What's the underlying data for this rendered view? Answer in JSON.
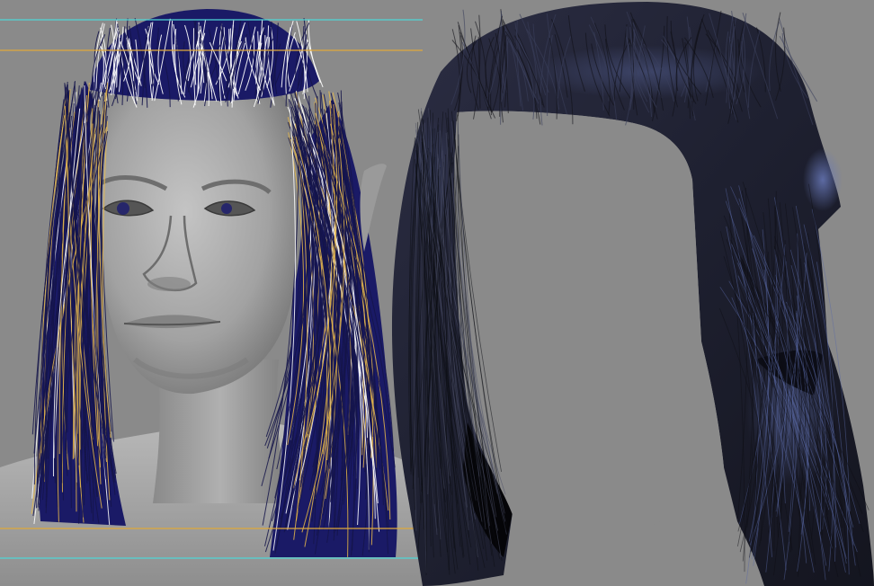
{
  "viewport": {
    "background_color": "#8a8a8a",
    "left_panel": {
      "subject": "wireframe-head-with-hair-guides",
      "hair_color": "#1a1a66",
      "guide_colors": [
        "#ffffff",
        "#e8b84a",
        "#15154a"
      ],
      "skin_color": "#9e9e9e",
      "guide_line_colors": [
        "#4fd6d6",
        "#e0a93a"
      ]
    },
    "right_panel": {
      "subject": "rendered-hair-only",
      "hair_color": "#222436",
      "highlight_color": "#5a6aa8"
    }
  }
}
